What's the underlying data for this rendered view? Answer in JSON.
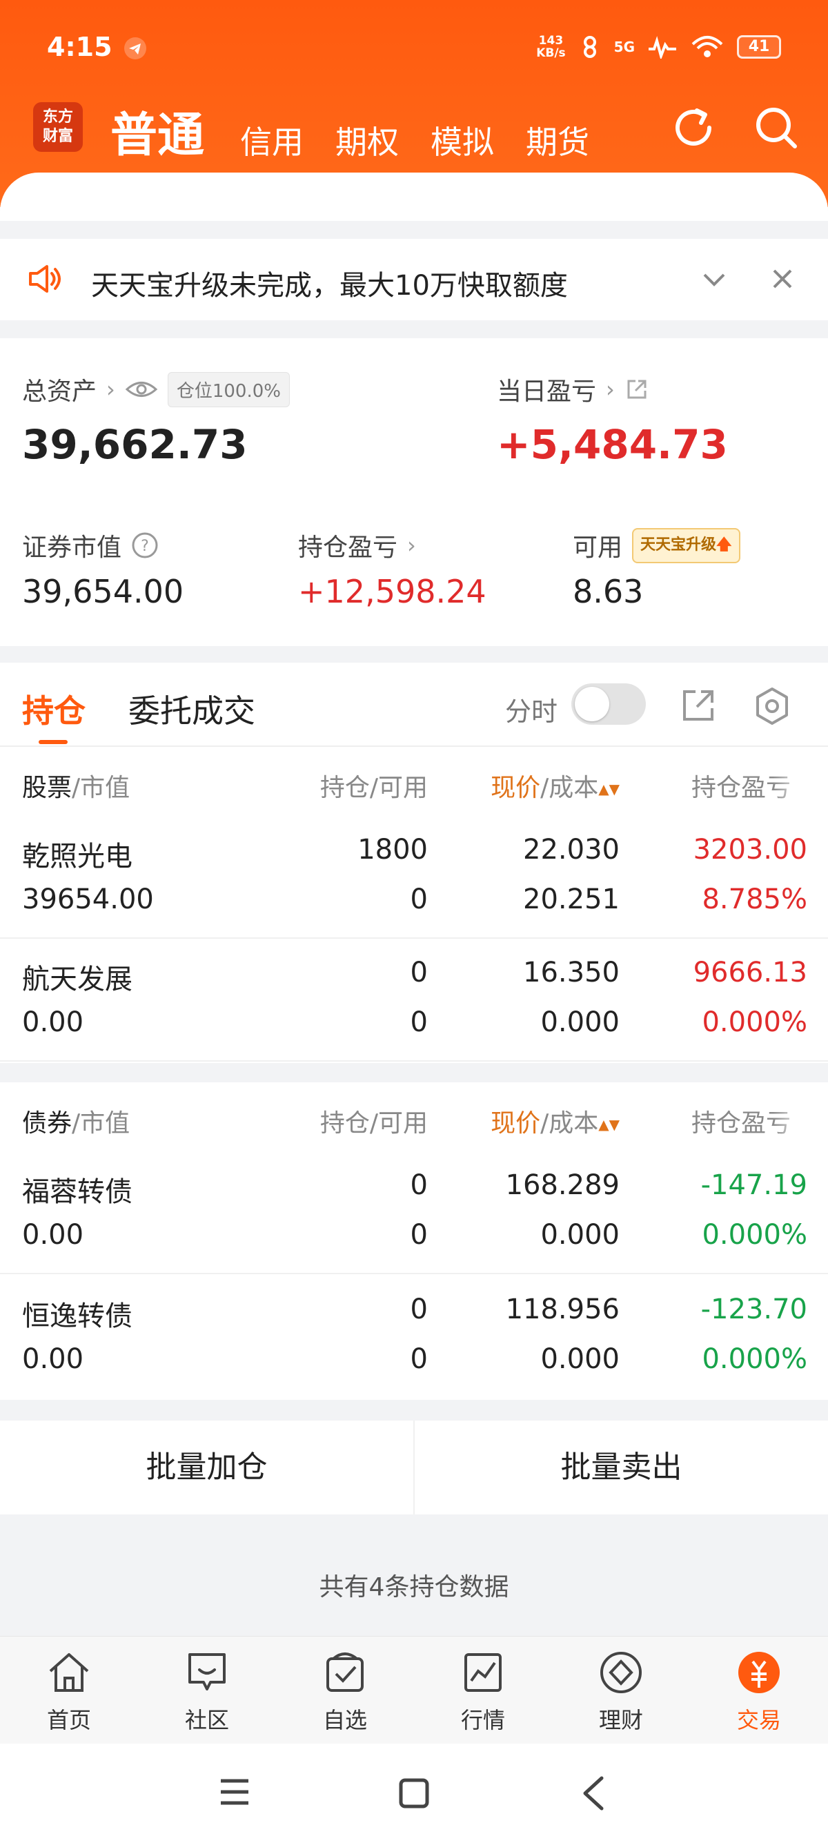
{
  "status_bar": {
    "time": "4:15",
    "net_speed_value": "143",
    "net_speed_unit": "KB/s",
    "network": "5G",
    "battery": "41"
  },
  "header": {
    "logo_line1": "东方",
    "logo_line2": "财富",
    "active_tab": "普通",
    "tabs": [
      "信用",
      "期权",
      "模拟",
      "期货"
    ]
  },
  "notice": {
    "text": "天天宝升级未完成，最大10万快取额度"
  },
  "assets": {
    "total_label": "总资产",
    "position_badge": "仓位100.0%",
    "total_value": "39,662.73",
    "daily_pl_label": "当日盈亏",
    "daily_pl_value": "+5,484.73",
    "securities_mv_label": "证券市值",
    "securities_mv_value": "39,654.00",
    "holding_pl_label": "持仓盈亏",
    "holding_pl_value": "+12,598.24",
    "available_label": "可用",
    "available_badge": "天天宝升级",
    "available_value": "8.63"
  },
  "positions_panel": {
    "tab_holdings": "持仓",
    "tab_orders": "委托成交",
    "timeshare_label": "分时",
    "timeshare_on": false,
    "stock_header": {
      "col1_main": "股票",
      "col1_sub": "/市值",
      "col2": "持仓/可用",
      "col3_main": "现价",
      "col3_sub": "/成本",
      "col4": "持仓盈亏"
    },
    "stocks": [
      {
        "name": "乾照光电",
        "market_value": "39654.00",
        "holding": "1800",
        "available": "0",
        "price": "22.030",
        "cost": "20.251",
        "pl": "3203.00",
        "pl_pct": "8.785%"
      },
      {
        "name": "航天发展",
        "market_value": "0.00",
        "holding": "0",
        "available": "0",
        "price": "16.350",
        "cost": "0.000",
        "pl": "9666.13",
        "pl_pct": "0.000%"
      }
    ],
    "bond_header": {
      "col1_main": "债券",
      "col1_sub": "/市值",
      "col2": "持仓/可用",
      "col3_main": "现价",
      "col3_sub": "/成本",
      "col4": "持仓盈亏"
    },
    "bonds": [
      {
        "name": "福蓉转债",
        "market_value": "0.00",
        "holding": "0",
        "available": "0",
        "price": "168.289",
        "cost": "0.000",
        "pl": "-147.19",
        "pl_pct": "0.000%"
      },
      {
        "name": "恒逸转债",
        "market_value": "0.00",
        "holding": "0",
        "available": "0",
        "price": "118.956",
        "cost": "0.000",
        "pl": "-123.70",
        "pl_pct": "0.000%"
      }
    ]
  },
  "batch": {
    "add": "批量加仓",
    "sell": "批量卖出"
  },
  "summary": {
    "count_text": "共有4条持仓数据"
  },
  "bottom_nav": {
    "items": [
      {
        "label": "首页",
        "icon": "home-icon"
      },
      {
        "label": "社区",
        "icon": "community-icon"
      },
      {
        "label": "自选",
        "icon": "watchlist-icon"
      },
      {
        "label": "行情",
        "icon": "market-icon"
      },
      {
        "label": "理财",
        "icon": "wealth-icon"
      },
      {
        "label": "交易",
        "icon": "trade-icon"
      }
    ],
    "active_index": 5
  },
  "colors": {
    "brand": "#ff5a0f",
    "gain": "#e02b2b",
    "loss": "#18a34a"
  }
}
